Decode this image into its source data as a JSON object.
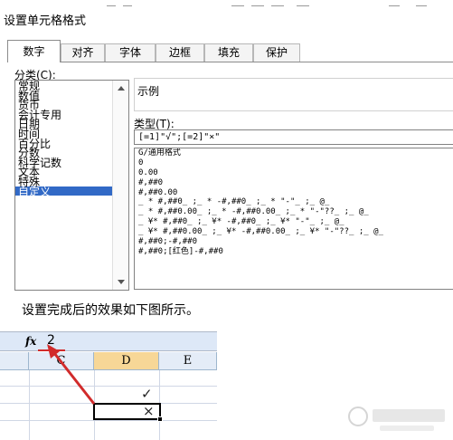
{
  "dialog": {
    "title": "设置单元格格式",
    "tabs": [
      "数字",
      "对齐",
      "字体",
      "边框",
      "填充",
      "保护"
    ],
    "active_tab": "数字"
  },
  "category": {
    "label": "分类(C):",
    "items": [
      "常规",
      "数值",
      "货币",
      "会计专用",
      "日期",
      "时间",
      "百分比",
      "分数",
      "科学记数",
      "文本",
      "特殊",
      "自定义"
    ],
    "selected": "自定义"
  },
  "sample": {
    "label": "示例"
  },
  "type": {
    "label": "类型(T):",
    "value": "[=1]\"√\";[=2]\"×\""
  },
  "format_list": [
    "G/通用格式",
    "0",
    "0.00",
    "#,##0",
    "#,##0.00",
    "_ * #,##0_ ;_ * -#,##0_ ;_ * \"-\"_ ;_ @_",
    "_ * #,##0.00_ ;_ * -#,##0.00_ ;_ * \"-\"??_ ;_ @_",
    "_ ¥* #,##0_ ;_ ¥* -#,##0_ ;_ ¥* \"-\"_ ;_ @_",
    "_ ¥* #,##0.00_ ;_ ¥* -#,##0.00_ ;_ ¥* \"-\"??_ ;_ @_",
    "#,##0;-#,##0",
    "#,##0;[红色]-#,##0"
  ],
  "caption": "设置完成后的效果如下图所示。",
  "sheet": {
    "fx_label": "fx",
    "formula_value": "2",
    "columns": [
      "C",
      "D",
      "E"
    ],
    "highlighted_column": "D",
    "cell_d_row1": "✓",
    "cell_d_row2": "×"
  },
  "colors": {
    "selection": "#3169c6",
    "arrow": "#d12b2b",
    "header_highlight": "#f7d797",
    "formula_bar": "#dde8f7"
  }
}
